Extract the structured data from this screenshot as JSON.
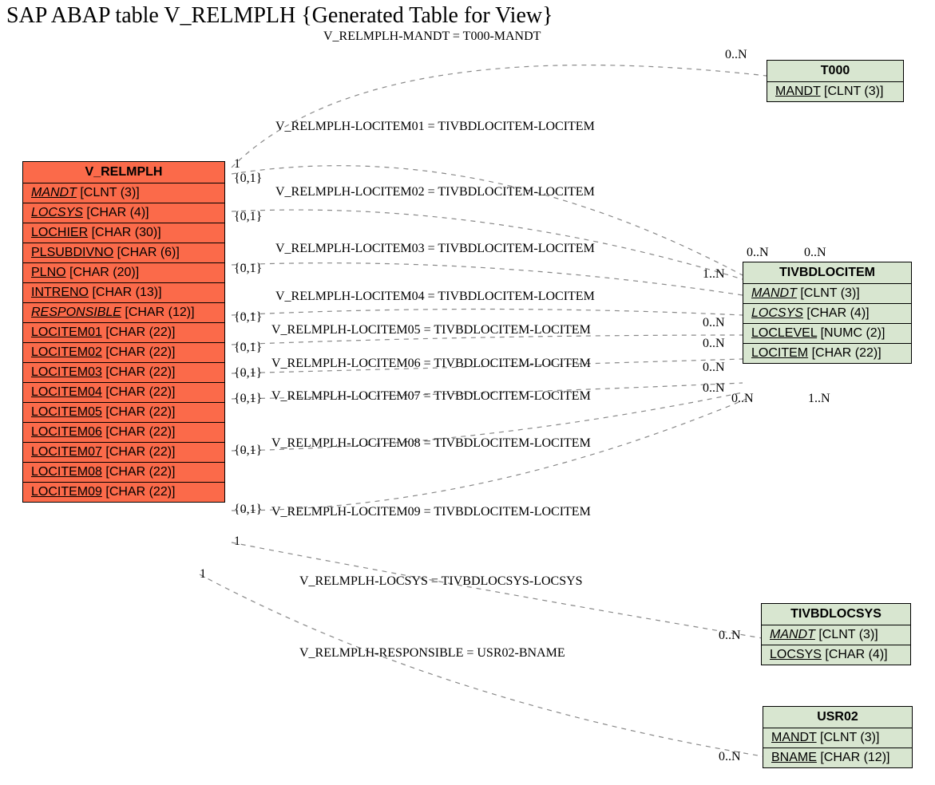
{
  "title": "SAP ABAP table V_RELMPLH {Generated Table for View}",
  "entities": {
    "v_relmplh": {
      "name": "V_RELMPLH",
      "fields": [
        {
          "n": "MANDT",
          "t": "[CLNT (3)]",
          "i": true
        },
        {
          "n": "LOCSYS",
          "t": "[CHAR (4)]",
          "i": true
        },
        {
          "n": "LOCHIER",
          "t": "[CHAR (30)]",
          "i": false
        },
        {
          "n": "PLSUBDIVNO",
          "t": "[CHAR (6)]",
          "i": false
        },
        {
          "n": "PLNO",
          "t": "[CHAR (20)]",
          "i": false
        },
        {
          "n": "INTRENO",
          "t": "[CHAR (13)]",
          "i": false
        },
        {
          "n": "RESPONSIBLE",
          "t": "[CHAR (12)]",
          "i": true
        },
        {
          "n": "LOCITEM01",
          "t": "[CHAR (22)]",
          "i": false
        },
        {
          "n": "LOCITEM02",
          "t": "[CHAR (22)]",
          "i": false
        },
        {
          "n": "LOCITEM03",
          "t": "[CHAR (22)]",
          "i": false
        },
        {
          "n": "LOCITEM04",
          "t": "[CHAR (22)]",
          "i": false
        },
        {
          "n": "LOCITEM05",
          "t": "[CHAR (22)]",
          "i": false
        },
        {
          "n": "LOCITEM06",
          "t": "[CHAR (22)]",
          "i": false
        },
        {
          "n": "LOCITEM07",
          "t": "[CHAR (22)]",
          "i": false
        },
        {
          "n": "LOCITEM08",
          "t": "[CHAR (22)]",
          "i": false
        },
        {
          "n": "LOCITEM09",
          "t": "[CHAR (22)]",
          "i": false
        }
      ]
    },
    "t000": {
      "name": "T000",
      "fields": [
        {
          "n": "MANDT",
          "t": "[CLNT (3)]",
          "i": false
        }
      ]
    },
    "tivbdlocitem": {
      "name": "TIVBDLOCITEM",
      "fields": [
        {
          "n": "MANDT",
          "t": "[CLNT (3)]",
          "i": true
        },
        {
          "n": "LOCSYS",
          "t": "[CHAR (4)]",
          "i": true
        },
        {
          "n": "LOCLEVEL",
          "t": "[NUMC (2)]",
          "i": false
        },
        {
          "n": "LOCITEM",
          "t": "[CHAR (22)]",
          "i": false
        }
      ]
    },
    "tivbdlocsys": {
      "name": "TIVBDLOCSYS",
      "fields": [
        {
          "n": "MANDT",
          "t": "[CLNT (3)]",
          "i": true
        },
        {
          "n": "LOCSYS",
          "t": "[CHAR (4)]",
          "i": false
        }
      ]
    },
    "usr02": {
      "name": "USR02",
      "fields": [
        {
          "n": "MANDT",
          "t": "[CLNT (3)]",
          "i": false
        },
        {
          "n": "BNAME",
          "t": "[CHAR (12)]",
          "i": false
        }
      ]
    }
  },
  "relations": [
    {
      "label": "V_RELMPLH-MANDT = T000-MANDT"
    },
    {
      "label": "V_RELMPLH-LOCITEM01 = TIVBDLOCITEM-LOCITEM"
    },
    {
      "label": "V_RELMPLH-LOCITEM02 = TIVBDLOCITEM-LOCITEM"
    },
    {
      "label": "V_RELMPLH-LOCITEM03 = TIVBDLOCITEM-LOCITEM"
    },
    {
      "label": "V_RELMPLH-LOCITEM04 = TIVBDLOCITEM-LOCITEM"
    },
    {
      "label": "V_RELMPLH-LOCITEM05 = TIVBDLOCITEM-LOCITEM"
    },
    {
      "label": "V_RELMPLH-LOCITEM06 = TIVBDLOCITEM-LOCITEM"
    },
    {
      "label": "V_RELMPLH-LOCITEM07 = TIVBDLOCITEM-LOCITEM"
    },
    {
      "label": "V_RELMPLH-LOCITEM08 = TIVBDLOCITEM-LOCITEM"
    },
    {
      "label": "V_RELMPLH-LOCITEM09 = TIVBDLOCITEM-LOCITEM"
    },
    {
      "label": "V_RELMPLH-LOCSYS = TIVBDLOCSYS-LOCSYS"
    },
    {
      "label": "V_RELMPLH-RESPONSIBLE = USR02-BNAME"
    }
  ],
  "cards": {
    "c1": "1",
    "c01": "{0,1}",
    "c0n": "0..N",
    "c1n": "1..N"
  }
}
